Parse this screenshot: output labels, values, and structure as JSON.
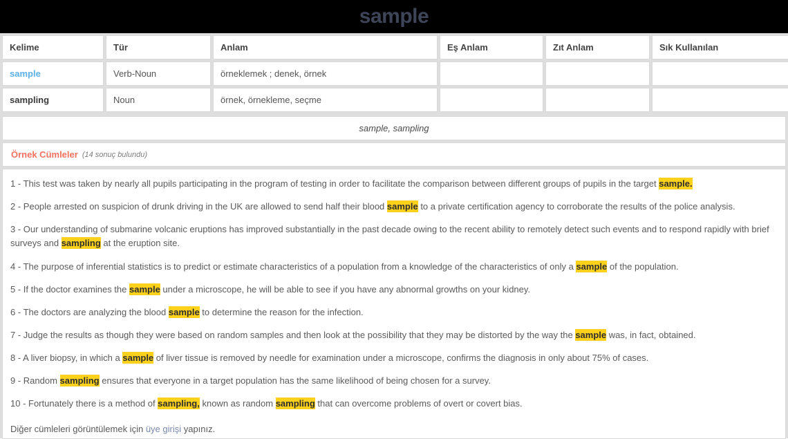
{
  "header": {
    "title": "sample"
  },
  "table": {
    "columns": [
      "Kelime",
      "Tür",
      "Anlam",
      "Eş Anlam",
      "Zıt Anlam",
      "Sık Kullanılan"
    ],
    "rows": [
      {
        "kelime": "sample",
        "kelime_is_link": true,
        "tur": "Verb-Noun",
        "anlam": "örneklemek ; denek, örnek",
        "es_anlam": "",
        "zit_anlam": "",
        "sik_kullanilan": ""
      },
      {
        "kelime": "sampling",
        "kelime_is_link": false,
        "tur": "Noun",
        "anlam": "örnek, örnekleme, seçme",
        "es_anlam": "",
        "zit_anlam": "",
        "sik_kullanilan": ""
      }
    ]
  },
  "variants": {
    "text": "sample, sampling"
  },
  "examples": {
    "title": "Örnek Cümleler",
    "count_text": "(14 sonuç bulundu)",
    "sentences": [
      {
        "number": "1 - ",
        "parts": [
          {
            "t": "This test was taken by nearly all pupils participating in the program of testing in order to facilitate the comparison between different groups of pupils in the target ",
            "hl": false
          },
          {
            "t": "sample.",
            "hl": true
          }
        ]
      },
      {
        "number": "2 - ",
        "parts": [
          {
            "t": "People arrested on suspicion of drunk driving in the UK are allowed to send half their blood ",
            "hl": false
          },
          {
            "t": "sample",
            "hl": true
          },
          {
            "t": " to a private certification agency to corroborate the results of the police analysis.",
            "hl": false
          }
        ]
      },
      {
        "number": "3 - ",
        "parts": [
          {
            "t": "Our understanding of submarine volcanic eruptions has improved substantially in the past decade owing to the recent ability to remotely detect such events and to respond rapidly with brief surveys and ",
            "hl": false
          },
          {
            "t": "sampling",
            "hl": true
          },
          {
            "t": " at the eruption site.",
            "hl": false
          }
        ]
      },
      {
        "number": "4 - ",
        "parts": [
          {
            "t": "The purpose of inferential statistics is to predict or estimate characteristics of a population from a knowledge of the characteristics of only a ",
            "hl": false
          },
          {
            "t": "sample",
            "hl": true
          },
          {
            "t": " of the population.",
            "hl": false
          }
        ]
      },
      {
        "number": "5 - ",
        "parts": [
          {
            "t": "If the doctor examines the ",
            "hl": false
          },
          {
            "t": "sample",
            "hl": true
          },
          {
            "t": " under a microscope, he will be able to see if you have any abnormal growths on your kidney.",
            "hl": false
          }
        ]
      },
      {
        "number": "6 - ",
        "parts": [
          {
            "t": "The doctors are analyzing the blood ",
            "hl": false
          },
          {
            "t": "sample",
            "hl": true
          },
          {
            "t": " to determine the reason for the infection.",
            "hl": false
          }
        ]
      },
      {
        "number": "7 - ",
        "parts": [
          {
            "t": "Judge the results as though they were based on random samples and then look at the possibility that they may be distorted by the way the ",
            "hl": false
          },
          {
            "t": "sample",
            "hl": true
          },
          {
            "t": " was, in fact, obtained.",
            "hl": false
          }
        ]
      },
      {
        "number": "8 - ",
        "parts": [
          {
            "t": "A liver biopsy, in which a ",
            "hl": false
          },
          {
            "t": "sample",
            "hl": true
          },
          {
            "t": " of liver tissue is removed by needle for examination under a microscope, confirms the diagnosis in only about 75% of cases.",
            "hl": false
          }
        ]
      },
      {
        "number": "9 - ",
        "parts": [
          {
            "t": "Random ",
            "hl": false
          },
          {
            "t": "sampling",
            "hl": true
          },
          {
            "t": " ensures that everyone in a target population has the same likelihood of being chosen for a survey.",
            "hl": false
          }
        ]
      },
      {
        "number": "10 - ",
        "parts": [
          {
            "t": "Fortunately there is a method of ",
            "hl": false
          },
          {
            "t": "sampling,",
            "hl": true
          },
          {
            "t": " known as random ",
            "hl": false
          },
          {
            "t": "sampling",
            "hl": true
          },
          {
            "t": " that can overcome problems of overt or covert bias.",
            "hl": false
          }
        ]
      }
    ],
    "footer_prefix": "Diğer cümleleri görüntülemek için ",
    "footer_link": "üye girişi",
    "footer_suffix": " yapınız."
  },
  "colors": {
    "header_bg": "#000000",
    "header_title": "#3e4559",
    "highlight": "#ffd11a",
    "examples_title": "#f4705f",
    "word_link": "#5cb0e8",
    "member_link": "#7a89a8",
    "sheet_bg": "#dedede"
  }
}
